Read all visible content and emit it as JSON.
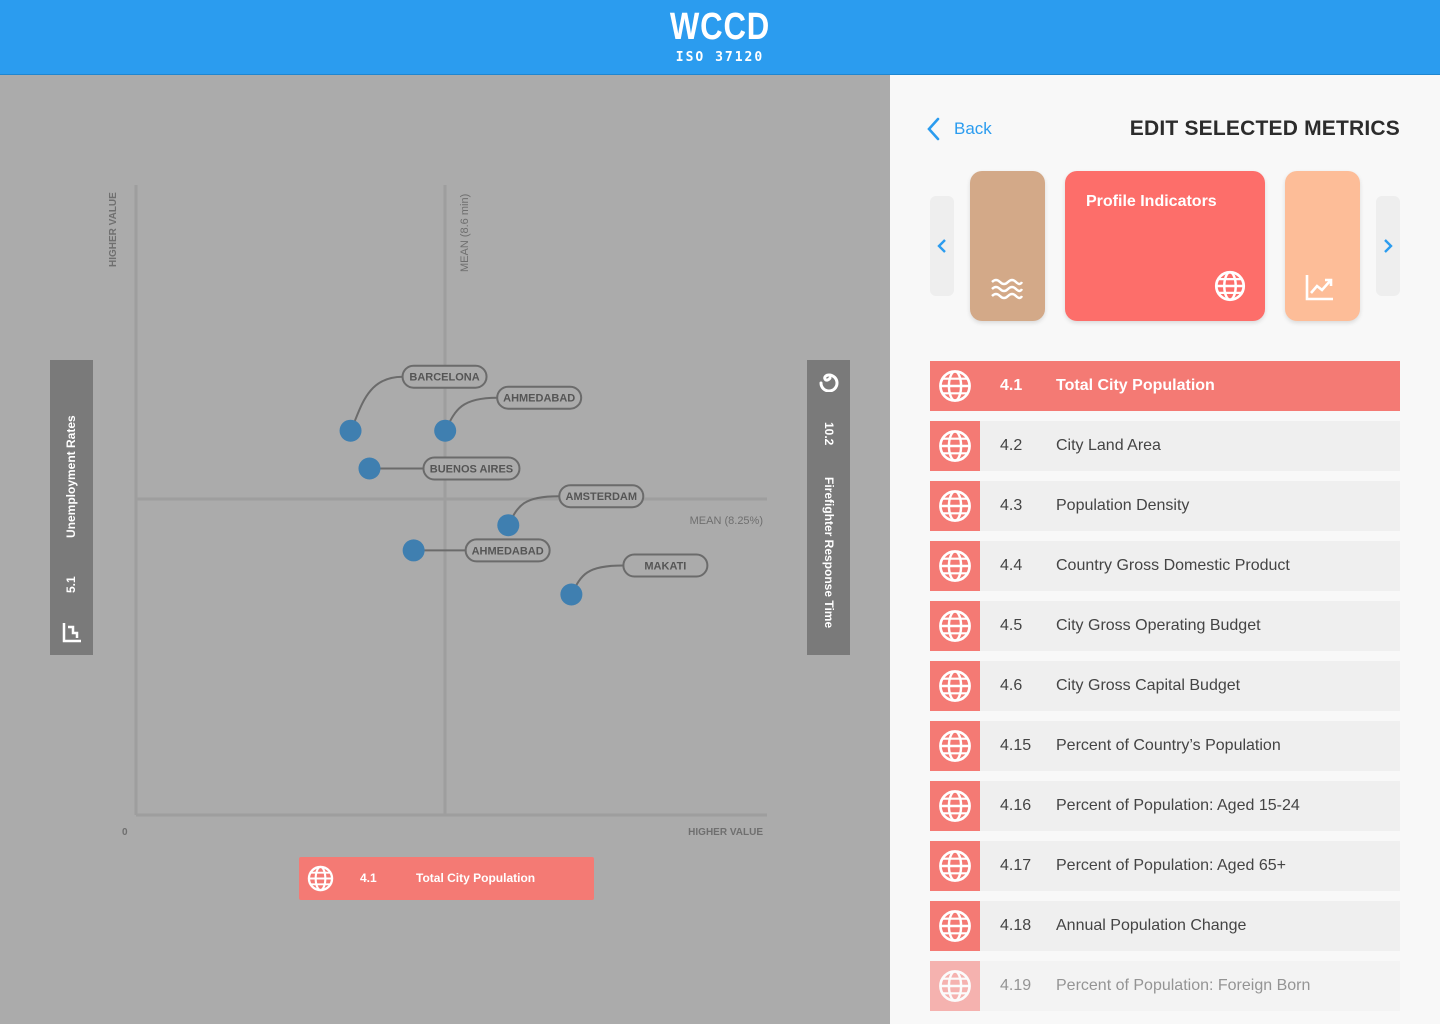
{
  "brand": {
    "name": "WCCD",
    "subtitle": "ISO 37120"
  },
  "colors": {
    "primary": "#2b9cef",
    "accent": "#f47a74",
    "point": "#3f7fb0"
  },
  "left_card": {
    "title": "Unemployment Rates",
    "value": "5.1",
    "icon": "stairs-chart-icon"
  },
  "right_card": {
    "title": "Firefighter Response Time",
    "value": "10.2",
    "icon": "flame-icon"
  },
  "bottom_metric": {
    "number": "4.1",
    "label": "Total City Population",
    "icon": "globe-icon"
  },
  "chart_data": {
    "type": "scatter",
    "y_axis_label": "HIGHER VALUE",
    "x_axis_label": "HIGHER VALUE",
    "origin_label": "0",
    "vertical_mean_label": "MEAN (8.6 min)",
    "horizontal_mean_label": "MEAN (8.25%)",
    "points": [
      {
        "name": "BARCELONA",
        "x": 0.34,
        "y": 0.61
      },
      {
        "name": "AHMEDABAD",
        "x": 0.49,
        "y": 0.61
      },
      {
        "name": "BUENOS AIRES",
        "x": 0.37,
        "y": 0.55
      },
      {
        "name": "AMSTERDAM",
        "x": 0.59,
        "y": 0.46
      },
      {
        "name": "AHMEDABAD",
        "x": 0.44,
        "y": 0.42
      },
      {
        "name": "MAKATI",
        "x": 0.69,
        "y": 0.35
      }
    ]
  },
  "panel": {
    "back_label": "Back",
    "title": "EDIT SELECTED METRICS",
    "categories": [
      {
        "title": "",
        "color": "#d3a988",
        "icon": "water-icon"
      },
      {
        "title": "Profile Indicators",
        "color": "#fd6e6a",
        "icon": "globe-icon"
      },
      {
        "title": "",
        "color": "#fdbd98",
        "icon": "trend-chart-icon"
      }
    ],
    "metrics": [
      {
        "number": "4.1",
        "name": "Total City Population",
        "selected": true
      },
      {
        "number": "4.2",
        "name": "City Land Area"
      },
      {
        "number": "4.3",
        "name": "Population Density"
      },
      {
        "number": "4.4",
        "name": "Country Gross Domestic Product"
      },
      {
        "number": "4.5",
        "name": "City Gross Operating Budget"
      },
      {
        "number": "4.6",
        "name": "City Gross Capital Budget"
      },
      {
        "number": "4.15",
        "name": "Percent of Country’s Population"
      },
      {
        "number": "4.16",
        "name": "Percent of Population: Aged 15-24"
      },
      {
        "number": "4.17",
        "name": "Percent of Population: Aged 65+"
      },
      {
        "number": "4.18",
        "name": "Annual Population Change"
      },
      {
        "number": "4.19",
        "name": "Percent of Population: Foreign Born"
      }
    ]
  }
}
